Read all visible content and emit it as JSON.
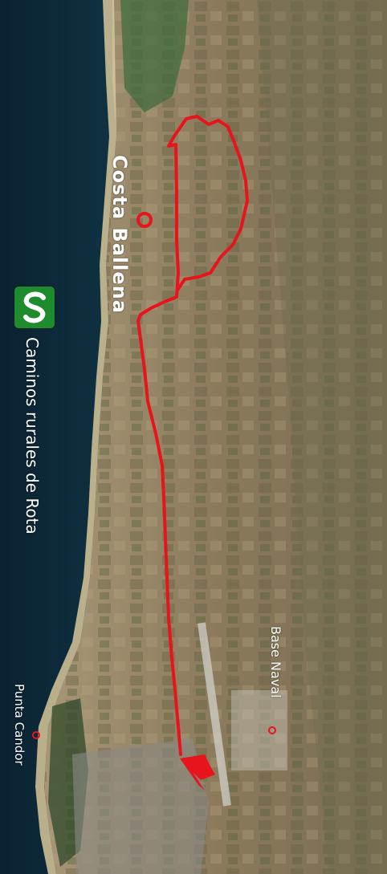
{
  "map": {
    "labels": {
      "costa_ballena": "Costa Ballena",
      "caminos": "Caminos rurales de Rota",
      "base_naval": "Base Naval",
      "punta_candor": "Punta Candor"
    },
    "colors": {
      "route": "#e8141b",
      "marker": "#e8141b",
      "sea": "#0d2a3a",
      "land": "#8a7b5c",
      "logo_bg": "#1e8c2c"
    },
    "icons": [
      "route-line",
      "start-flag-icon",
      "location-marker-icon",
      "logo-icon"
    ]
  }
}
